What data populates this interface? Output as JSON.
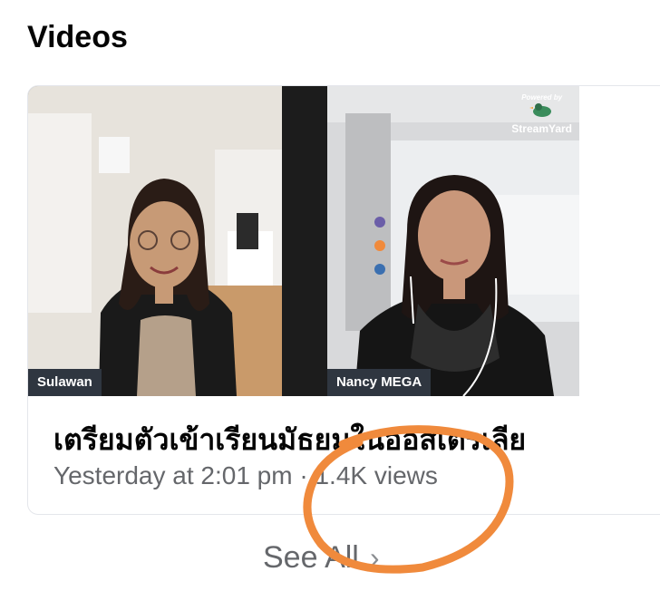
{
  "section": {
    "title": "Videos"
  },
  "video_card": {
    "participants": [
      {
        "name": "Sulawan"
      },
      {
        "name": "Nancy MEGA"
      }
    ],
    "branding": {
      "powered_by": "Powered by",
      "name": "StreamYard"
    },
    "title": "เตรียมตัวเข้าเรียนมัธยมในออสเตรเลีย",
    "meta": "Yesterday at 2:01 pm · 1.4K views"
  },
  "footer": {
    "see_all_label": "See All"
  },
  "colors": {
    "annotation_circle": "#f08a3c",
    "name_tag_bg": "#2f3640",
    "meta_text": "#65676b"
  }
}
